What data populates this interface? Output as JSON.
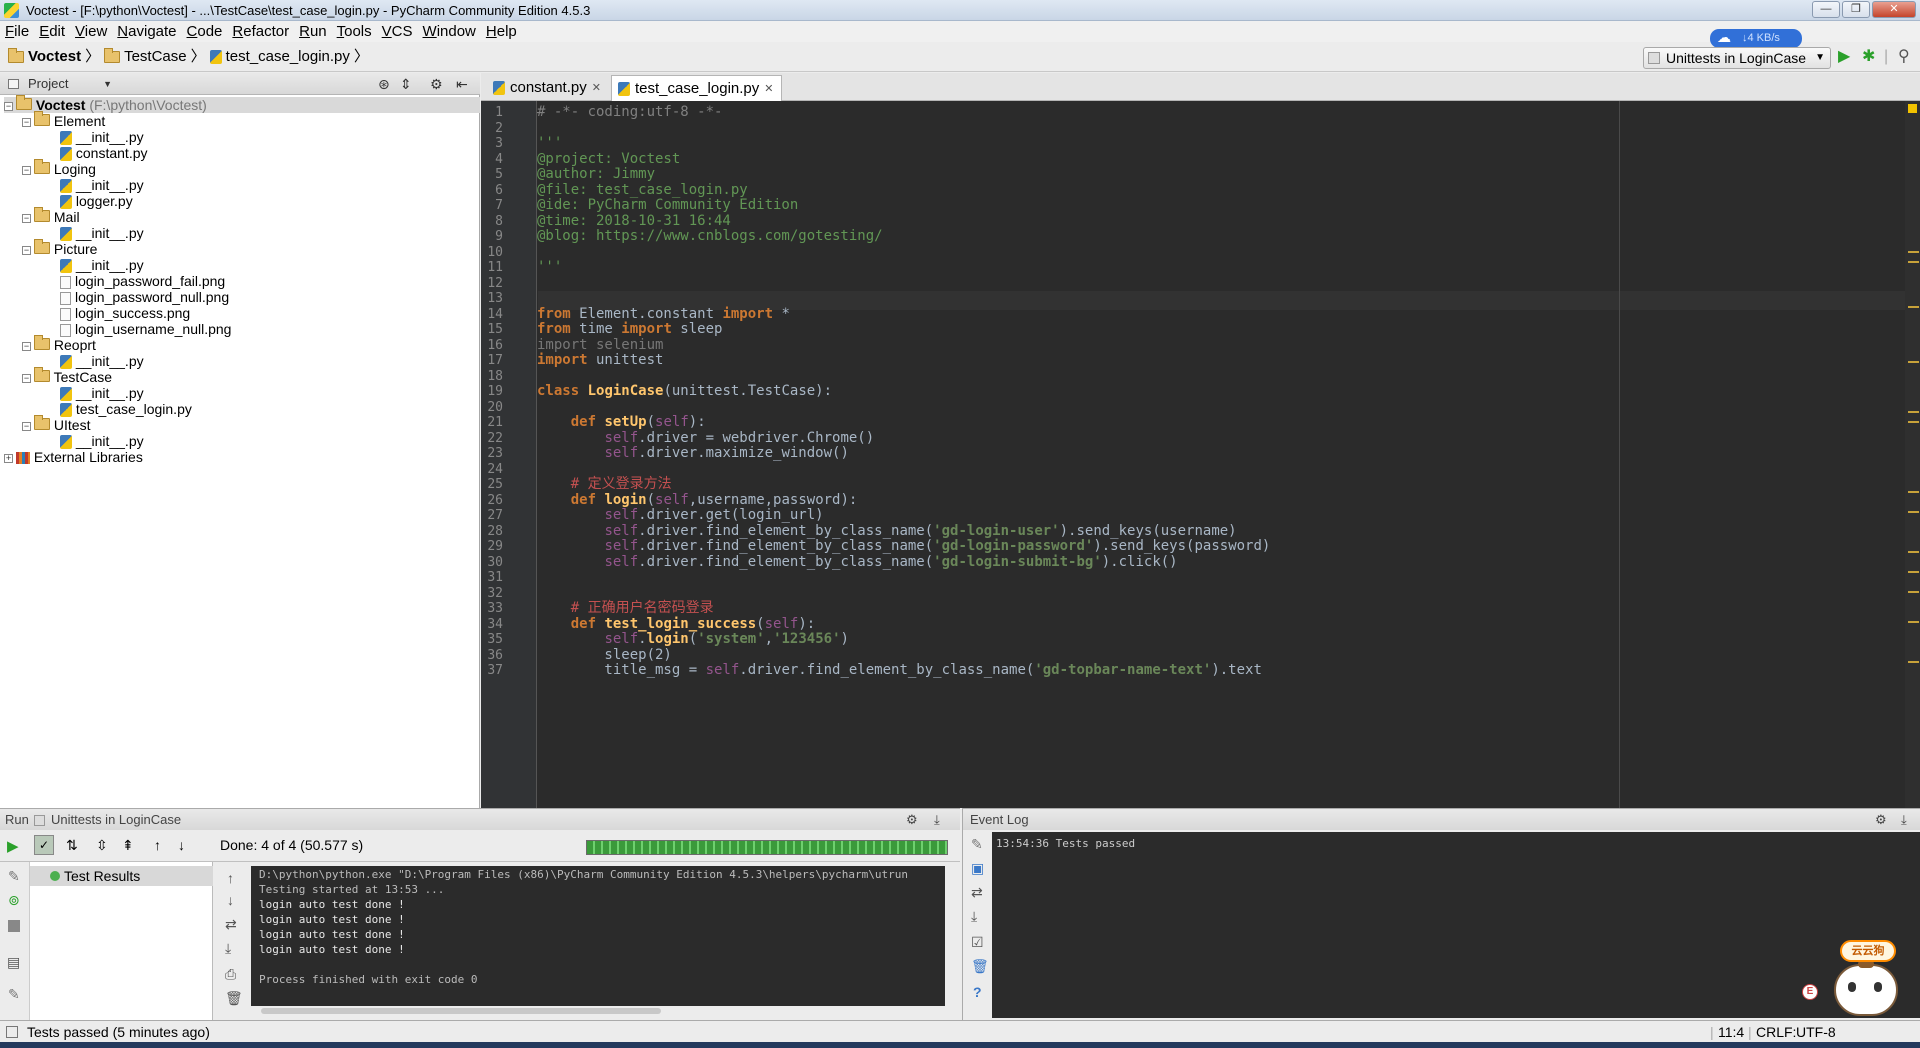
{
  "window": {
    "title": "Voctest - [F:\\python\\Voctest] - ...\\TestCase\\test_case_login.py - PyCharm Community Edition 4.5.3"
  },
  "menu": [
    "File",
    "Edit",
    "View",
    "Navigate",
    "Code",
    "Refactor",
    "Run",
    "Tools",
    "VCS",
    "Window",
    "Help"
  ],
  "breadcrumb": {
    "project": "Voctest",
    "folder": "TestCase",
    "file": "test_case_login.py"
  },
  "toolbar": {
    "run_config": "Unittests in LoginCase",
    "net_speed": "4 KB/s"
  },
  "project_panel": {
    "title": "Project"
  },
  "tree": {
    "root": "Voctest",
    "root_path": "(F:\\python\\Voctest)",
    "element": "Element",
    "init": "__init__.py",
    "constant": "constant.py",
    "loging": "Loging",
    "logger": "logger.py",
    "mail": "Mail",
    "picture": "Picture",
    "png1": "login_password_fail.png",
    "png2": "login_password_null.png",
    "png3": "login_success.png",
    "png4": "login_username_null.png",
    "reoprt": "Reoprt",
    "testcase": "TestCase",
    "testfile": "test_case_login.py",
    "uitest": "UItest",
    "ext": "External Libraries"
  },
  "tabs": [
    {
      "label": "constant.py"
    },
    {
      "label": "test_case_login.py"
    }
  ],
  "code": {
    "l1": "# -*- coding:utf-8 -*-",
    "l3": "'''",
    "l4": "@project: Voctest",
    "l5": "@author: Jimmy",
    "l6": "@file: test_case_login.py",
    "l7": "@ide: PyCharm Community Edition",
    "l8": "@time: 2018-10-31 16:44",
    "l9": "@blog: https://www.cnblogs.com/gotesting/",
    "l11": "'''",
    "l14": "from Element.constant import *",
    "l15": "from time import sleep",
    "l16": "import selenium",
    "l17": "import unittest",
    "l19": "class LoginCase(unittest.TestCase):",
    "l21": "    def setUp(self):",
    "l22": "        self.driver = webdriver.Chrome()",
    "l23": "        self.driver.maximize_window()",
    "l25": "    # 定义登录方法",
    "l26": "    def login(self,username,password):",
    "l27": "        self.driver.get(login_url)",
    "l28": "        self.driver.find_element_by_class_name('gd-login-user').send_keys(username)",
    "l29": "        self.driver.find_element_by_class_name('gd-login-password').send_keys(password)",
    "l30": "        self.driver.find_element_by_class_name('gd-login-submit-bg').click()",
    "l33": "    # 正确用户名密码登录",
    "l34": "    def test_login_success(self):",
    "l35": "        self.login('system','123456')",
    "l36": "        sleep(2)",
    "l37": "        title_msg = self.driver.find_element_by_class_name('gd-topbar-name-text').text"
  },
  "run": {
    "label": "Run",
    "config": "Unittests in LoginCase",
    "status": "Done: 4 of 4  (50.577 s)",
    "results": "Test Results",
    "console": {
      "c1": "D:\\python\\python.exe \"D:\\Program Files (x86)\\PyCharm Community Edition 4.5.3\\helpers\\pycharm\\utrun",
      "c2": "Testing started at 13:53 ...",
      "c3": "login auto test done !",
      "c4": "login auto test done !",
      "c5": "login auto test done !",
      "c6": "login auto test done !",
      "c8": "Process finished with exit code 0"
    }
  },
  "event_log": {
    "title": "Event Log",
    "entry": "13:54:36 Tests passed"
  },
  "status": {
    "message": "Tests passed (5 minutes ago)",
    "position": "11:4",
    "line_sep": "CRLF:",
    "encoding": "UTF-8"
  },
  "mascot": {
    "text": "云云狗"
  },
  "colors": {
    "editor_bg": "#2b2b2b",
    "keyword": "#cc7832",
    "string": "#6a8759",
    "comment": "#808080",
    "docstring": "#629755"
  }
}
